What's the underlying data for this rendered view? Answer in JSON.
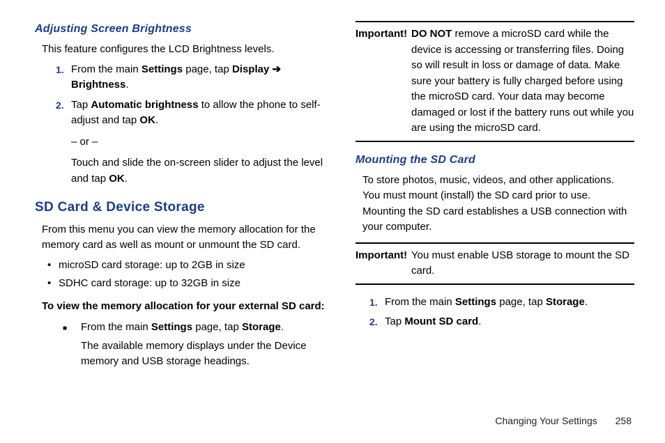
{
  "left": {
    "heading1": "Adjusting Screen Brightness",
    "intro1": "This feature configures the LCD Brightness levels.",
    "step1_num": "1.",
    "step1_a": "From the main ",
    "step1_b": "Settings",
    "step1_c": " page, tap ",
    "step1_d": "Display",
    "step1_arrow": " ➔ ",
    "step1_e": "Brightness",
    "step1_f": ".",
    "step2_num": "2.",
    "step2_a": "Tap ",
    "step2_b": "Automatic brightness",
    "step2_c": " to allow the phone to self-adjust and tap ",
    "step2_d": "OK",
    "step2_e": ".",
    "or": "– or –",
    "step2_alt_a": "Touch and slide the on-screen slider to adjust the level and tap ",
    "step2_alt_b": "OK",
    "step2_alt_c": ".",
    "heading2": "SD Card & Device Storage",
    "intro2": "From this menu you can view the memory allocation for the memory card as well as mount or unmount the SD card.",
    "bullet1": "microSD card storage: up to 2GB in size",
    "bullet2": "SDHC card storage: up to 32GB in size",
    "boldline": "To view the memory allocation for your external SD card:",
    "sq1_a": "From the main ",
    "sq1_b": "Settings",
    "sq1_c": " page, tap ",
    "sq1_d": "Storage",
    "sq1_e": ".",
    "sq1_sub": "The available memory displays under the Device memory and USB storage headings."
  },
  "right": {
    "imp1_label": "Important!",
    "imp1_a": " ",
    "imp1_b": "DO NOT",
    "imp1_c": " remove a microSD card while the device is accessing or transferring files. Doing so will result in loss or damage of data. Make sure your battery is fully charged before using the microSD card. Your data may become damaged or lost if the battery runs out while you are using the microSD card.",
    "heading3": "Mounting the SD Card",
    "intro3": "To store photos, music, videos, and other applications. You must mount (install) the SD card prior to use. Mounting the SD card establishes a USB connection with your computer.",
    "imp2_label": "Important!",
    "imp2_text": " You must enable USB storage to mount the SD card.",
    "r1_num": "1.",
    "r1_a": "From the main ",
    "r1_b": "Settings",
    "r1_c": " page, tap ",
    "r1_d": "Storage",
    "r1_e": ".",
    "r2_num": "2.",
    "r2_a": "Tap ",
    "r2_b": "Mount SD card",
    "r2_c": "."
  },
  "footer": {
    "section": "Changing Your Settings",
    "page": "258"
  }
}
